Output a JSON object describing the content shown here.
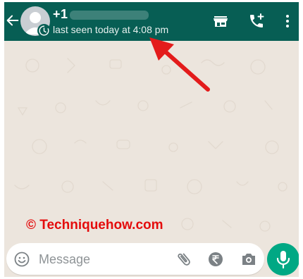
{
  "header": {
    "contact_name": "+1",
    "status": "last seen today at 4:08 pm",
    "bg_color": "#075e54",
    "icons": [
      "back-arrow-icon",
      "store-icon",
      "add-call-icon",
      "more-vert-icon"
    ]
  },
  "annotation": {
    "watermark": "© Techniquehow.com",
    "arrow_color": "#e31b1b"
  },
  "composer": {
    "placeholder": "Message",
    "icons": [
      "emoji-icon",
      "attach-icon",
      "rupee-icon",
      "camera-icon",
      "mic-icon"
    ],
    "send_color": "#00a884"
  }
}
